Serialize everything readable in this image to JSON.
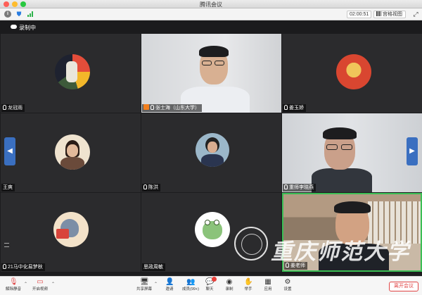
{
  "window": {
    "title": "腾讯会议"
  },
  "topbar": {
    "timer": "02:00:51",
    "view_label": "宫格视图"
  },
  "recording": {
    "label": "录制中"
  },
  "participants": [
    {
      "name": "龙冠雨"
    },
    {
      "name": "张士海（山东大学）"
    },
    {
      "name": "姜玉娇"
    },
    {
      "name": "王爽"
    },
    {
      "name": "陈洪"
    },
    {
      "name": "重师李晓燕"
    },
    {
      "name": "21马中化易梦秋"
    },
    {
      "name": "思政周敏"
    },
    {
      "name": "姜老师"
    }
  ],
  "watermark": {
    "text": "重庆师范大学"
  },
  "toolbar": {
    "mute": "解除静音",
    "video": "开启视频",
    "share": "共享屏幕",
    "invite": "邀请",
    "members": "成员(99+)",
    "chat": "聊天",
    "record": "录制",
    "raise": "举手",
    "apps": "应用",
    "settings": "设置",
    "leave": "离开会议"
  }
}
